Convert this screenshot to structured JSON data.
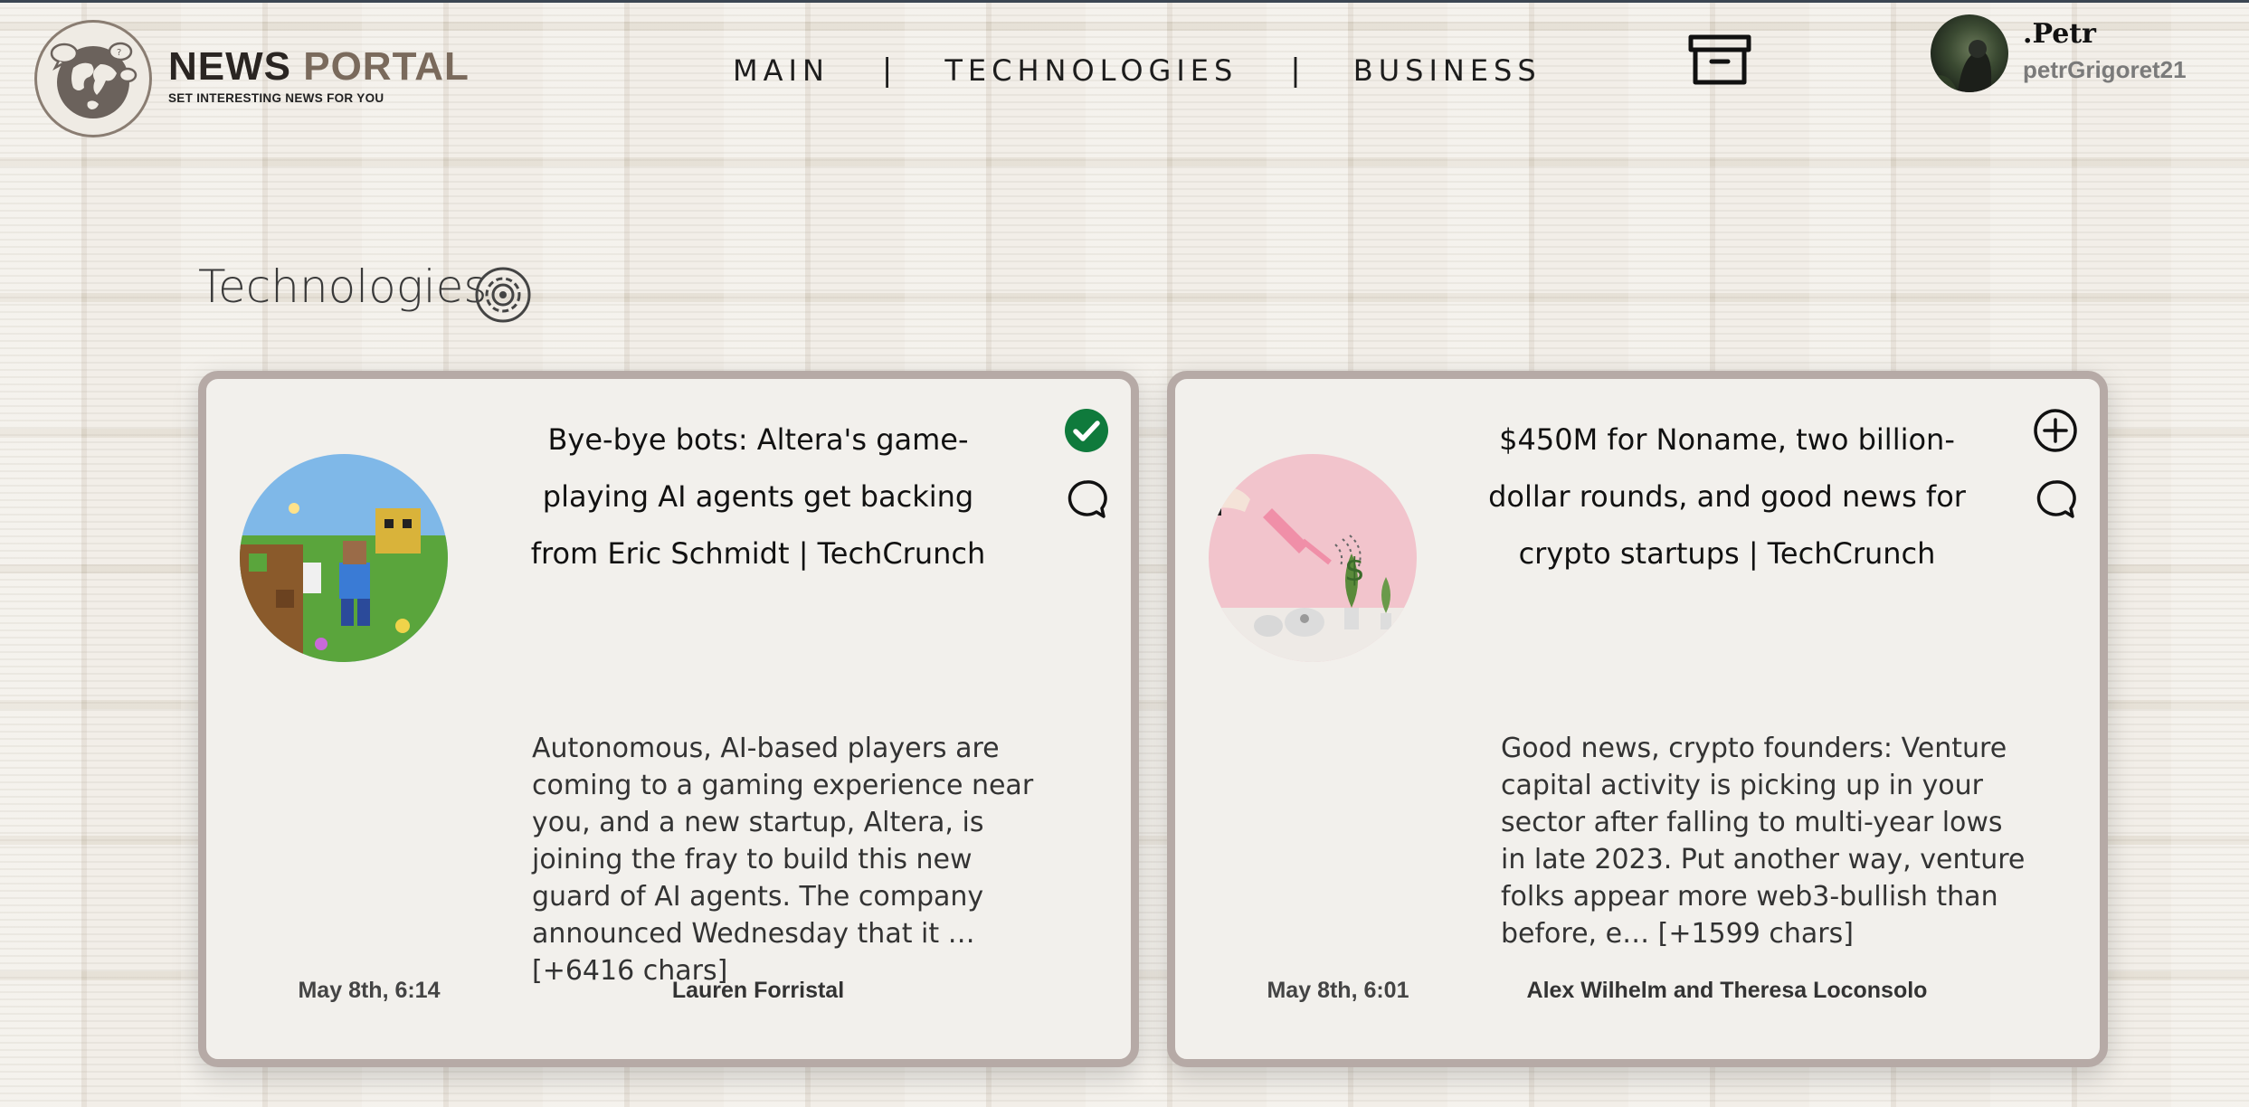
{
  "brand": {
    "title_part1": "NEWS",
    "title_part2": "PORTAL",
    "subtitle": "SET INTERESTING NEWS FOR YOU",
    "logo_icon": "globe-chat-icon"
  },
  "nav": {
    "items": [
      {
        "label": "MAIN"
      },
      {
        "label": "TECHNOLOGIES"
      },
      {
        "label": "BUSINESS"
      }
    ],
    "separator": "|"
  },
  "header": {
    "archive_icon": "archive-box-icon"
  },
  "user": {
    "display_name": ".Petr",
    "handle": "petrGrigoret21"
  },
  "section": {
    "title": "Technologies",
    "icon": "tech-gear-icon"
  },
  "articles": [
    {
      "title": "Bye-bye bots: Altera's game-playing AI agents get backing from Eric Schmidt | TechCrunch",
      "description": "Autonomous, AI-based players are coming to a gaming experience near you, and a new startup, Altera, is joining the fray to build this new guard of AI agents. The company announced Wednesday that it … [+6416 chars]",
      "date": "May 8th, 6:14",
      "author": "Lauren Forristal",
      "saved": true,
      "primary_action_icon": "check-circle-icon",
      "comment_icon": "comment-icon",
      "thumbnail": "minecraft-scene-image"
    },
    {
      "title": "$450M for Noname, two billion-dollar rounds, and good news for crypto startups | TechCrunch",
      "description": "Good news, crypto founders: Venture capital activity is picking up in your sector after falling to multi-year lows in late 2023. Put another way, venture folks appear more web3-bullish than before, e… [+1599 chars]",
      "date": "May 8th, 6:01",
      "author": "Alex Wilhelm and Theresa Loconsolo",
      "saved": false,
      "primary_action_icon": "plus-circle-icon",
      "comment_icon": "comment-icon",
      "thumbnail": "watering-money-plants-image"
    }
  ],
  "colors": {
    "card_border": "#b6aaa6",
    "card_bg": "#f2f0ec",
    "saved_green": "#0f7a3c",
    "brand_accent": "#7a6a5c"
  }
}
